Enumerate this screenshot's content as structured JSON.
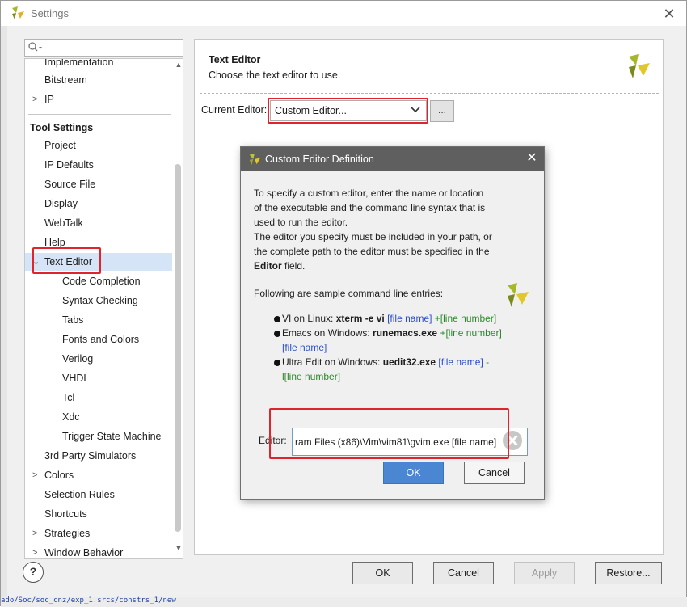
{
  "window": {
    "title": "Settings"
  },
  "tree": {
    "search_placeholder": "",
    "items": [
      {
        "label": "Implementation",
        "indent": 1,
        "arrow": ""
      },
      {
        "label": "Bitstream",
        "indent": 1,
        "arrow": ""
      },
      {
        "label": "IP",
        "indent": 1,
        "arrow": ">"
      },
      {
        "label": "Tool Settings",
        "indent": 0,
        "arrow": "",
        "header": true
      },
      {
        "label": "Project",
        "indent": 1,
        "arrow": ""
      },
      {
        "label": "IP Defaults",
        "indent": 1,
        "arrow": ""
      },
      {
        "label": "Source File",
        "indent": 1,
        "arrow": ""
      },
      {
        "label": "Display",
        "indent": 1,
        "arrow": ""
      },
      {
        "label": "WebTalk",
        "indent": 1,
        "arrow": ""
      },
      {
        "label": "Help",
        "indent": 1,
        "arrow": ""
      },
      {
        "label": "Text Editor",
        "indent": 1,
        "arrow": "⌄",
        "selected": true
      },
      {
        "label": "Code Completion",
        "indent": 2,
        "arrow": ""
      },
      {
        "label": "Syntax Checking",
        "indent": 2,
        "arrow": ""
      },
      {
        "label": "Tabs",
        "indent": 2,
        "arrow": ""
      },
      {
        "label": "Fonts and Colors",
        "indent": 2,
        "arrow": ""
      },
      {
        "label": "Verilog",
        "indent": 2,
        "arrow": ""
      },
      {
        "label": "VHDL",
        "indent": 2,
        "arrow": ""
      },
      {
        "label": "Tcl",
        "indent": 2,
        "arrow": ""
      },
      {
        "label": "Xdc",
        "indent": 2,
        "arrow": ""
      },
      {
        "label": "Trigger State Machine",
        "indent": 2,
        "arrow": ""
      },
      {
        "label": "3rd Party Simulators",
        "indent": 1,
        "arrow": ""
      },
      {
        "label": "Colors",
        "indent": 1,
        "arrow": ">"
      },
      {
        "label": "Selection Rules",
        "indent": 1,
        "arrow": ""
      },
      {
        "label": "Shortcuts",
        "indent": 1,
        "arrow": ""
      },
      {
        "label": "Strategies",
        "indent": 1,
        "arrow": ">"
      },
      {
        "label": "Window Behavior",
        "indent": 1,
        "arrow": ">"
      }
    ]
  },
  "panel": {
    "title": "Text Editor",
    "description": "Choose the text editor to use.",
    "current_editor_label": "Current Editor:",
    "current_editor_value": "Custom Editor...",
    "browse_label": "..."
  },
  "buttons": {
    "help": "?",
    "ok": "OK",
    "cancel": "Cancel",
    "apply": "Apply",
    "restore": "Restore..."
  },
  "dialog": {
    "title": "Custom Editor Definition",
    "body_lines": [
      "To specify a custom editor, enter the name or location",
      "of the executable and the command line syntax that is",
      "used to run the editor.",
      "The editor you specify must be included in your path, or",
      "the complete path to the editor must be specified in the"
    ],
    "body_last_bold": "Editor",
    "body_last_rest": " field.",
    "samples_intro": "Following are sample command line entries:",
    "samples": [
      {
        "prefix": "VI on Linux: ",
        "cmd": "xterm -e vi",
        "arg1": " [file name]",
        "arg2": " +[line number]",
        "arg1_color": "blue",
        "arg2_color": "green"
      },
      {
        "prefix": "Emacs on Windows: ",
        "cmd": "runemacs.exe",
        "arg1": " +[line number]",
        "arg2": " [file name]",
        "arg1_color": "green",
        "arg2_color": "blue"
      },
      {
        "prefix": "Ultra Edit on Windows: ",
        "cmd": "uedit32.exe",
        "arg1": " [file name]",
        "arg2": " -l[line number]",
        "arg1_color": "blue",
        "arg2_color": "green"
      }
    ],
    "editor_label": "Editor:",
    "editor_value": "ram Files (x86)\\Vim\\vim81\\gvim.exe  [file name]",
    "ok": "OK",
    "cancel": "Cancel"
  },
  "background": {
    "bottom_text": "ado/Soc/soc_cnz/exp_1.srcs/constrs_1/new"
  },
  "colors": {
    "accent_blue": "#4a86d2",
    "highlight_red": "#e0242c",
    "selection": "#d5e4f6",
    "dialog_title_bg": "#5f5f5f"
  }
}
